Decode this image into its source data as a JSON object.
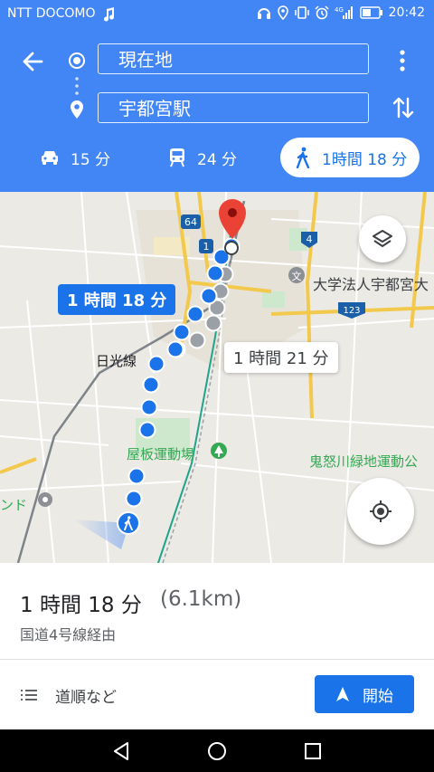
{
  "status_bar": {
    "carrier": "NTT DOCOMO",
    "time": "20:42",
    "icons": [
      "music-note-icon",
      "headphones-icon",
      "location-icon",
      "vibrate-icon",
      "alarm-icon",
      "signal-icon",
      "battery-icon"
    ]
  },
  "header": {
    "origin": "現在地",
    "destination": "宇都宮駅",
    "modes": [
      {
        "icon": "car-icon",
        "label": "15 分"
      },
      {
        "icon": "train-icon",
        "label": "24 分"
      },
      {
        "icon": "walk-icon",
        "label": "1時間 18 分",
        "active": true
      }
    ]
  },
  "map": {
    "primary_route_label": "1 時間 18 分",
    "alt_route_label": "1 時間 21 分",
    "road_badges": [
      "64",
      "1",
      "4",
      "123"
    ],
    "places": [
      "大学法人宇都宮大",
      "日光線",
      "屋板運動場",
      "鬼怒川緑地運動公",
      "ンド"
    ],
    "route_color": "#1A73E8",
    "alt_route_color": "#9AA0A6"
  },
  "panel": {
    "duration": "1 時間 18 分",
    "distance": "(6.1km)",
    "via": "国道4号線経由",
    "steps_label": "道順など",
    "start_label": "開始"
  }
}
